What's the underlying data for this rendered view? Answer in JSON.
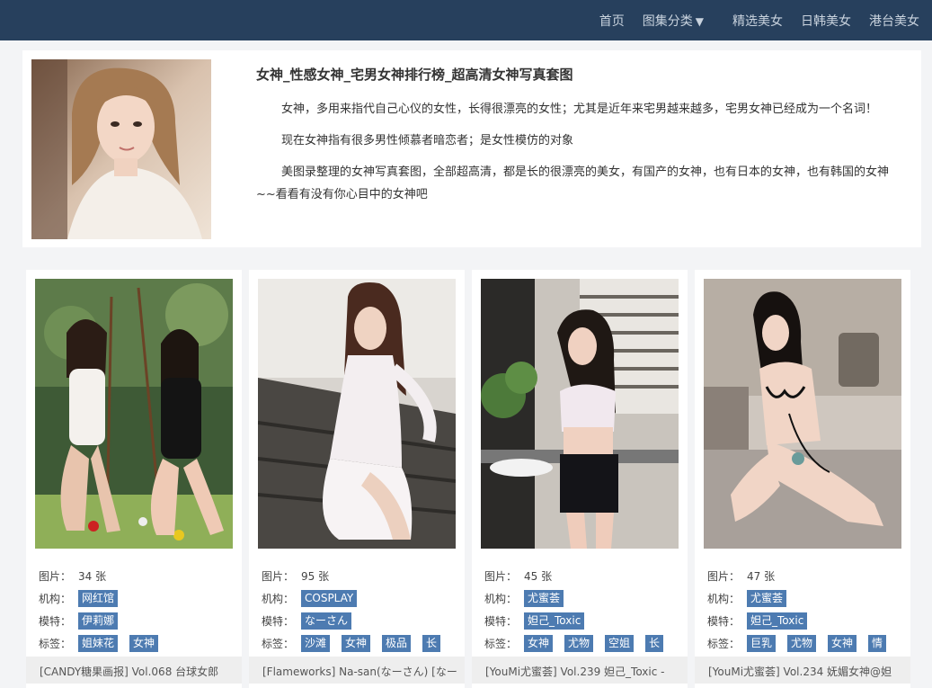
{
  "nav": {
    "home": "首页",
    "categories": "图集分类",
    "featured": "精选美女",
    "jpkr": "日韩美女",
    "hktw": "港台美女"
  },
  "intro": {
    "title": "女神_性感女神_宅男女神排行榜_超高清女神写真套图",
    "p1": "女神，多用来指代自己心仪的女性，长得很漂亮的女性；尤其是近年来宅男越来越多，宅男女神已经成为一个名词！",
    "p2": "现在女神指有很多男性倾慕者暗恋者；是女性模仿的对象",
    "p3": "美图录整理的女神写真套图，全部超高清，都是长的很漂亮的美女，有国产的女神，也有日本的女神，也有韩国的女神~~看看有没有你心目中的女神吧"
  },
  "labels": {
    "pics": "图片：",
    "org": "机构：",
    "model": "模特：",
    "tags": "标签："
  },
  "cards": [
    {
      "pics": "34 张",
      "org": "网红馆",
      "model": "伊莉娜",
      "tags": [
        "姐妹花",
        "女神"
      ],
      "title": "[CANDY糖果画报] Vol.068 台球女郎"
    },
    {
      "pics": "95 张",
      "org": "COSPLAY",
      "model": "なーさん",
      "tags": [
        "沙滩",
        "女神",
        "极品",
        "长"
      ],
      "title": "[Flameworks] Na-san(なーさん) [なー"
    },
    {
      "pics": "45 张",
      "org": "尤蜜荟",
      "model": "妲己_Toxic",
      "tags": [
        "女神",
        "尤物",
        "空姐",
        "长"
      ],
      "title": "[YouMi尤蜜荟] Vol.239 妲己_Toxic -"
    },
    {
      "pics": "47 张",
      "org": "尤蜜荟",
      "model": "妲己_Toxic",
      "tags": [
        "巨乳",
        "尤物",
        "女神",
        "情"
      ],
      "title": "[YouMi尤蜜荟] Vol.234 妩媚女神@妲"
    }
  ]
}
